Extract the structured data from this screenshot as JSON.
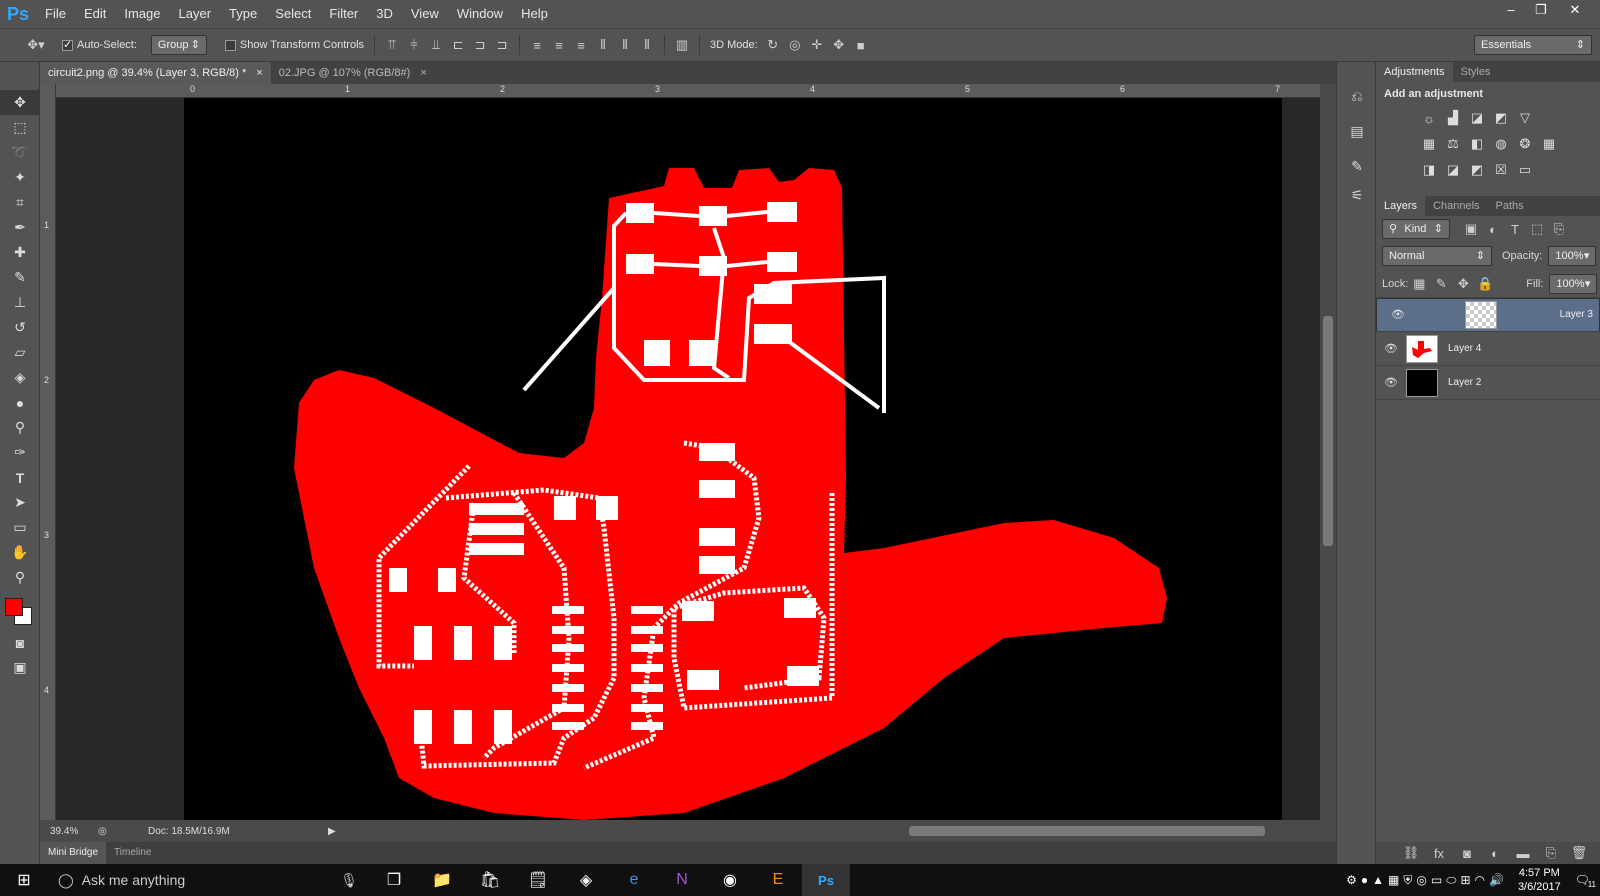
{
  "app": {
    "logo": "Ps",
    "menu": [
      "File",
      "Edit",
      "Image",
      "Layer",
      "Type",
      "Select",
      "Filter",
      "3D",
      "View",
      "Window",
      "Help"
    ],
    "window_controls": [
      "minimize-icon",
      "restore-icon",
      "close-icon"
    ]
  },
  "options": {
    "auto_select_label": "Auto-Select:",
    "auto_select_checked": true,
    "auto_select_value": "Group",
    "transform_label": "Show Transform Controls",
    "mode_label": "3D Mode:",
    "workspace": "Essentials"
  },
  "documents": {
    "tabs": [
      {
        "title": "circuit2.png @ 39.4% (Layer 3, RGB/8) *",
        "active": true
      },
      {
        "title": "02.JPG @ 107% (RGB/8#)",
        "active": false
      }
    ]
  },
  "rulers": {
    "h": [
      "0",
      "1",
      "2",
      "3",
      "4",
      "5",
      "6",
      "7"
    ],
    "v": [
      "1",
      "2",
      "3",
      "4"
    ]
  },
  "status": {
    "zoom": "39.4%",
    "doc": "Doc: 18.5M/16.9M"
  },
  "bottom_tabs": [
    "Mini Bridge",
    "Timeline"
  ],
  "adjustments": {
    "tabs": [
      "Adjustments",
      "Styles"
    ],
    "title": "Add an adjustment"
  },
  "layers_panel": {
    "tabs": [
      "Layers",
      "Channels",
      "Paths"
    ],
    "kind": "Kind",
    "blend": "Normal",
    "opacity_label": "Opacity:",
    "opacity": "100%",
    "lock_label": "Lock:",
    "fill_label": "Fill:",
    "fill": "100%",
    "layers": [
      {
        "name": "Layer 3",
        "selected": true,
        "thumb": "transparent"
      },
      {
        "name": "Layer 4",
        "selected": false,
        "thumb": "hand"
      },
      {
        "name": "Layer 2",
        "selected": false,
        "thumb": "black"
      }
    ]
  },
  "colors": {
    "foreground": "#ff0000",
    "background": "#ffffff",
    "hand": "#ff0000"
  },
  "taskbar": {
    "search_placeholder": "Ask me anything",
    "time": "4:57 PM",
    "date": "3/6/2017",
    "notifications": "11"
  }
}
